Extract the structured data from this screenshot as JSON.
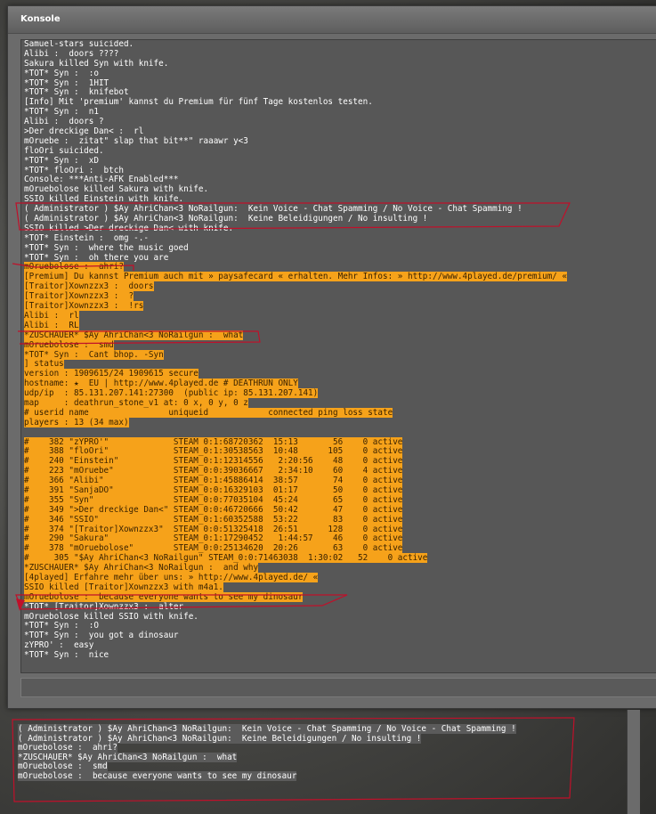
{
  "window": {
    "title": "Konsole"
  },
  "console": {
    "lines": [
      {
        "text": "Samuel-stars suicided.",
        "hl": ""
      },
      {
        "text": "Alibi :  doors ????",
        "hl": ""
      },
      {
        "text": "Sakura killed Syn with knife.",
        "hl": ""
      },
      {
        "text": "*TOT* Syn :  :o",
        "hl": ""
      },
      {
        "text": "*TOT* Syn :  1HIT",
        "hl": ""
      },
      {
        "text": "*TOT* Syn :  knifebot",
        "hl": ""
      },
      {
        "text": "[Info] Mit 'premium' kannst du Premium für fünf Tage kostenlos testen.",
        "hl": ""
      },
      {
        "text": "*TOT* Syn :  n1",
        "hl": ""
      },
      {
        "text": "Alibi :  doors ?",
        "hl": ""
      },
      {
        "text": ">Der dreckige Dan< :  rl",
        "hl": ""
      },
      {
        "text": "mOruebe :  zitat\" slap that bit**\" raaawr y<3",
        "hl": ""
      },
      {
        "text": "floOri suicided.",
        "hl": ""
      },
      {
        "text": "*TOT* Syn :  xD",
        "hl": ""
      },
      {
        "text": "*TOT* floOri :  btch",
        "hl": ""
      },
      {
        "text": "Console: ***Anti-AFK Enabled***",
        "hl": ""
      },
      {
        "text": "mOruebolose killed Sakura with knife.",
        "hl": ""
      },
      {
        "text": "SSIO killed Einstein with knife.",
        "hl": ""
      },
      {
        "text": "( Administrator ) $Ay AhriChan<3 NoRailgun:  Kein Voice - Chat Spamming / No Voice - Chat Spamming !",
        "hl": ""
      },
      {
        "text": "( Administrator ) $Ay AhriChan<3 NoRailgun:  Keine Beleidigungen / No insulting !",
        "hl": ""
      },
      {
        "text": "SSIO killed >Der dreckige Dan< with knife.",
        "hl": ""
      },
      {
        "text": "*TOT* Einstein :  omg -.-",
        "hl": ""
      },
      {
        "text": "*TOT* Syn :  where the music goed",
        "hl": ""
      },
      {
        "text": "*TOT* Syn :  oh there you are",
        "hl": ""
      },
      {
        "text": "mOruebolose :  ahri?",
        "hl": "o"
      },
      {
        "text": "[Premium] Du kannst Premium auch mit » paysafecard « erhalten. Mehr Infos: » http://www.4played.de/premium/ «",
        "hl": "o"
      },
      {
        "text": "[Traitor]Xownzzx3 :  doors",
        "hl": "o"
      },
      {
        "text": "[Traitor]Xownzzx3 :  ?",
        "hl": "o"
      },
      {
        "text": "[Traitor]Xownzzx3 :  !rs",
        "hl": "o"
      },
      {
        "text": "Alibi :  rl",
        "hl": "o"
      },
      {
        "text": "Alibi :  RL",
        "hl": "o"
      },
      {
        "text": "*ZUSCHAUER* $Ay AhriChan<3 NoRailgun :  what",
        "hl": "o"
      },
      {
        "text": "mOruebolose :  smd",
        "hl": "o"
      },
      {
        "text": "*TOT* Syn :  Cant bhop. -Syn",
        "hl": "o"
      },
      {
        "text": "] status",
        "hl": "o"
      },
      {
        "text": "version : 1909615/24 1909615 secure",
        "hl": "o"
      },
      {
        "text": "hostname: ★  EU | http://www.4played.de # DEATHRUN ONLY",
        "hl": "o"
      },
      {
        "text": "udp/ip  : 85.131.207.141:27300  (public ip: 85.131.207.141)",
        "hl": "o"
      },
      {
        "text": "map     : deathrun_stone_v1 at: 0 x, 0 y, 0 z",
        "hl": "o"
      },
      {
        "text": "# userid name                uniqueid            connected ping loss state",
        "hl": "o"
      },
      {
        "text": "players : 13 (34 max)",
        "hl": "o"
      },
      {
        "text": "",
        "hl": "b"
      },
      {
        "text": "#    382 \"zYPRO'\"             STEAM_0:1:68720362  15:13       56    0 active",
        "hl": "o"
      },
      {
        "text": "#    388 \"floOri\"             STEAM_0:1:30538563  10:48      105    0 active",
        "hl": "o"
      },
      {
        "text": "#    240 \"Einstein\"           STEAM_0:1:12314556   2:20:56    48    0 active",
        "hl": "o"
      },
      {
        "text": "#    223 \"mOruebe\"            STEAM_0:0:39036667   2:34:10    60    4 active",
        "hl": "o"
      },
      {
        "text": "#    366 \"Alibi\"              STEAM_0:1:45886414  38:57       74    0 active",
        "hl": "o"
      },
      {
        "text": "#    391 \"SanjaDO\"            STEAM_0:0:16329103  01:17       50    0 active",
        "hl": "o"
      },
      {
        "text": "#    355 \"Syn\"                STEAM_0:0:77035104  45:24       65    0 active",
        "hl": "o"
      },
      {
        "text": "#    349 \">Der dreckige Dan<\" STEAM_0:0:46720666  50:42       47    0 active",
        "hl": "o"
      },
      {
        "text": "#    346 \"SSIO\"               STEAM_0:1:60352588  53:22       83    0 active",
        "hl": "o"
      },
      {
        "text": "#    374 \"[Traitor]Xownzzx3\"  STEAM_0:0:51325418  26:51      128    0 active",
        "hl": "o"
      },
      {
        "text": "#    290 \"Sakura\"             STEAM_0:1:17290452   1:44:57    46    0 active",
        "hl": "o"
      },
      {
        "text": "#    378 \"mOruebolose\"        STEAM_0:0:25134620  20:26       63    0 active",
        "hl": "o"
      },
      {
        "text": "#     305 \"$Ay AhriChan<3 NoRailgun\" STEAM_0:0:71463038  1:30:02   52    0 active",
        "hl": "o"
      },
      {
        "text": "*ZUSCHAUER* $Ay AhriChan<3 NoRailgun :  and why",
        "hl": "o"
      },
      {
        "text": "[4played] Erfahre mehr über uns: » http://www.4played.de/ «",
        "hl": "o"
      },
      {
        "text": "SSIO killed [Traitor]Xownzzx3 with m4a1.",
        "hl": "o"
      },
      {
        "text": "mOruebolose :  because everyone wants to see my dinosaur",
        "hl": "o"
      },
      {
        "text": "*TOT* [Traitor]Xownzzx3 :  alter",
        "hl": ""
      },
      {
        "text": "mOruebolose killed SSIO with knife.",
        "hl": ""
      },
      {
        "text": "*TOT* Syn :  :O",
        "hl": ""
      },
      {
        "text": "*TOT* Syn :  you got a dinosaur",
        "hl": ""
      },
      {
        "text": "zYPRO' :  easy",
        "hl": ""
      },
      {
        "text": "*TOT* Syn :  nice",
        "hl": ""
      }
    ]
  },
  "chat_overlay": {
    "lines": [
      "( Administrator ) $Ay AhriChan<3 NoRailgun:  Kein Voice - Chat Spamming / No Voice - Chat Spamming !",
      "( Administrator ) $Ay AhriChan<3 NoRailgun:  Keine Beleidigungen / No insulting !",
      "mOruebolose :  ahri?",
      "*ZUSCHAUER* $Ay AhriChan<3 NoRailgun :  what",
      "mOruebolose :  smd",
      "mOruebolose :  because everyone wants to see my dinosaur"
    ]
  },
  "colors": {
    "highlight": "#f6a21a",
    "annotation": "#c0102a"
  }
}
